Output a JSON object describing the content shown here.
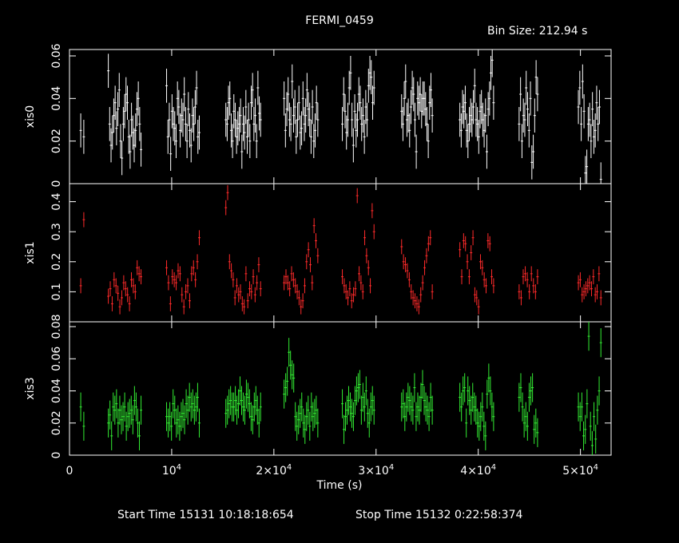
{
  "chart_data": {
    "type": "scatter",
    "title": "FERMI_0459",
    "bin_size_label": "Bin Size: 212.94 s",
    "xlabel": "Time (s)",
    "xlim": [
      0,
      53000
    ],
    "x_ticks": [
      {
        "value": 0,
        "label": "0"
      },
      {
        "value": 10000,
        "label": "10^4"
      },
      {
        "value": 20000,
        "label": "2×10^4"
      },
      {
        "value": 30000,
        "label": "3×10^4"
      },
      {
        "value": 40000,
        "label": "4×10^4"
      },
      {
        "value": 50000,
        "label": "5×10^4"
      }
    ],
    "footer": {
      "start": "Start Time 15131 10:18:18:654",
      "stop": "Stop Time 15132  0:22:58:374"
    },
    "grid": false,
    "panels": [
      {
        "name": "xis0",
        "ylabel": "xis0",
        "color": "#ffffff",
        "ylim": [
          0,
          0.063
        ],
        "y_ticks": [
          {
            "value": 0,
            "label": "0"
          },
          {
            "value": 0.02,
            "label": "0.02"
          },
          {
            "value": 0.04,
            "label": "0.04"
          },
          {
            "value": 0.06,
            "label": "0.06"
          }
        ],
        "groups": [
          [
            1100,
            1400
          ],
          [
            3800,
            7000
          ],
          [
            9500,
            12700
          ],
          [
            15300,
            18700
          ],
          [
            21000,
            24300
          ],
          [
            26700,
            29800
          ],
          [
            32500,
            35500
          ],
          [
            38200,
            41500
          ],
          [
            44000,
            45800
          ],
          [
            49800,
            52000
          ]
        ],
        "values": [
          0.025,
          0.022,
          0.053,
          0.028,
          0.018,
          0.024,
          0.032,
          0.038,
          0.026,
          0.035,
          0.044,
          0.02,
          0.012,
          0.028,
          0.034,
          0.042,
          0.038,
          0.022,
          0.015,
          0.03,
          0.024,
          0.018,
          0.025,
          0.035,
          0.04,
          0.028,
          0.016,
          0.046,
          0.022,
          0.03,
          0.014,
          0.034,
          0.028,
          0.026,
          0.02,
          0.04,
          0.036,
          0.025,
          0.032,
          0.03,
          0.042,
          0.028,
          0.02,
          0.035,
          0.025,
          0.018,
          0.032,
          0.028,
          0.036,
          0.045,
          0.022,
          0.024,
          0.03,
          0.028,
          0.038,
          0.04,
          0.025,
          0.02,
          0.034,
          0.03,
          0.022,
          0.026,
          0.028,
          0.032,
          0.015,
          0.028,
          0.024,
          0.036,
          0.022,
          0.03,
          0.02,
          0.038,
          0.044,
          0.028,
          0.032,
          0.02,
          0.045,
          0.033,
          0.03,
          0.04,
          0.025,
          0.035,
          0.042,
          0.03,
          0.028,
          0.048,
          0.032,
          0.036,
          0.022,
          0.03,
          0.038,
          0.024,
          0.026,
          0.04,
          0.028,
          0.032,
          0.044,
          0.035,
          0.03,
          0.022,
          0.036,
          0.02,
          0.025,
          0.038,
          0.03,
          0.028,
          0.042,
          0.034,
          0.024,
          0.03,
          0.045,
          0.052,
          0.03,
          0.018,
          0.034,
          0.025,
          0.03,
          0.042,
          0.038,
          0.028,
          0.032,
          0.022,
          0.036,
          0.03,
          0.046,
          0.052,
          0.05,
          0.038,
          0.045,
          0.034,
          0.028,
          0.04,
          0.048,
          0.03,
          0.032,
          0.025,
          0.036,
          0.045,
          0.042,
          0.03,
          0.015,
          0.04,
          0.038,
          0.042,
          0.034,
          0.04,
          0.04,
          0.035,
          0.028,
          0.02,
          0.038,
          0.044,
          0.032,
          0.03,
          0.025,
          0.036,
          0.034,
          0.038,
          0.025,
          0.02,
          0.028,
          0.032,
          0.03,
          0.036,
          0.046,
          0.03,
          0.028,
          0.022,
          0.034,
          0.036,
          0.03,
          0.025,
          0.032,
          0.015,
          0.035,
          0.04,
          0.052,
          0.058,
          0.038,
          0.028,
          0.042,
          0.02,
          0.032,
          0.03,
          0.045,
          0.035,
          0.025,
          0.04,
          0.01,
          0.015,
          0.032,
          0.05,
          0.042,
          0.036,
          0.045,
          0.028,
          0.048,
          0.034,
          0.005,
          0.008,
          0.028,
          0.03,
          0.02,
          0.035,
          0.022,
          0.025,
          0.038,
          0.028,
          0.036,
          0.002
        ],
        "err": 0.008
      },
      {
        "name": "xis1",
        "ylabel": "xis1",
        "color": "#ff2a2a",
        "ylim": [
          0,
          0.46
        ],
        "y_ticks": [
          {
            "value": 0.1,
            "label": "0.1"
          },
          {
            "value": 0.2,
            "label": "0.2"
          },
          {
            "value": 0.3,
            "label": "0.3"
          },
          {
            "value": 0.4,
            "label": "0.4"
          }
        ],
        "groups": [
          [
            1100,
            1400
          ],
          [
            3800,
            7000
          ],
          [
            9500,
            12700
          ],
          [
            15300,
            18700
          ],
          [
            21000,
            24300
          ],
          [
            26700,
            29800
          ],
          [
            32500,
            35500
          ],
          [
            38200,
            41500
          ],
          [
            44000,
            45800
          ],
          [
            49800,
            52000
          ]
        ],
        "values": [
          0.12,
          0.34,
          0.085,
          0.11,
          0.06,
          0.14,
          0.12,
          0.095,
          0.05,
          0.08,
          0.13,
          0.11,
          0.09,
          0.06,
          0.14,
          0.12,
          0.1,
          0.18,
          0.16,
          0.15,
          0.18,
          0.13,
          0.06,
          0.15,
          0.14,
          0.13,
          0.17,
          0.16,
          0.09,
          0.05,
          0.1,
          0.12,
          0.07,
          0.16,
          0.18,
          0.14,
          0.2,
          0.28,
          0.38,
          0.43,
          0.2,
          0.17,
          0.14,
          0.08,
          0.12,
          0.09,
          0.1,
          0.06,
          0.05,
          0.16,
          0.07,
          0.11,
          0.1,
          0.15,
          0.09,
          0.13,
          0.19,
          0.11,
          0.13,
          0.15,
          0.13,
          0.11,
          0.16,
          0.14,
          0.12,
          0.1,
          0.08,
          0.05,
          0.07,
          0.12,
          0.2,
          0.24,
          0.19,
          0.13,
          0.32,
          0.27,
          0.22,
          0.15,
          0.12,
          0.1,
          0.08,
          0.11,
          0.07,
          0.09,
          0.11,
          0.42,
          0.16,
          0.13,
          0.1,
          0.28,
          0.22,
          0.18,
          0.12,
          0.37,
          0.3,
          0.25,
          0.2,
          0.19,
          0.17,
          0.14,
          0.1,
          0.08,
          0.07,
          0.06,
          0.05,
          0.09,
          0.13,
          0.18,
          0.22,
          0.26,
          0.28,
          0.1,
          0.24,
          0.15,
          0.27,
          0.26,
          0.2,
          0.15,
          0.23,
          0.28,
          0.09,
          0.08,
          0.05,
          0.2,
          0.18,
          0.14,
          0.12,
          0.27,
          0.26,
          0.15,
          0.12,
          0.1,
          0.08,
          0.15,
          0.16,
          0.14,
          0.1,
          0.16,
          0.12,
          0.1,
          0.15,
          0.13,
          0.14,
          0.09,
          0.1,
          0.11,
          0.12,
          0.13,
          0.11,
          0.15,
          0.09,
          0.1,
          0.16,
          0.08
        ],
        "err": 0.025
      },
      {
        "name": "xis3",
        "ylabel": "xis3",
        "color": "#33ee33",
        "ylim": [
          0,
          0.083
        ],
        "y_ticks": [
          {
            "value": 0,
            "label": "0"
          },
          {
            "value": 0.02,
            "label": "0.02"
          },
          {
            "value": 0.04,
            "label": "0.04"
          },
          {
            "value": 0.06,
            "label": "0.06"
          },
          {
            "value": 0.08,
            "label": "0.08"
          }
        ],
        "groups": [
          [
            1100,
            1400
          ],
          [
            3800,
            7000
          ],
          [
            9500,
            12700
          ],
          [
            15300,
            18700
          ],
          [
            21000,
            24300
          ],
          [
            26700,
            29800
          ],
          [
            32500,
            35500
          ],
          [
            38200,
            41500
          ],
          [
            44000,
            45800
          ],
          [
            49800,
            52000
          ]
        ],
        "values": [
          0.03,
          0.018,
          0.02,
          0.025,
          0.012,
          0.03,
          0.028,
          0.032,
          0.02,
          0.028,
          0.022,
          0.024,
          0.03,
          0.018,
          0.024,
          0.026,
          0.028,
          0.022,
          0.034,
          0.03,
          0.02,
          0.012,
          0.028,
          0.024,
          0.02,
          0.024,
          0.018,
          0.032,
          0.028,
          0.02,
          0.022,
          0.018,
          0.024,
          0.026,
          0.022,
          0.032,
          0.028,
          0.036,
          0.03,
          0.032,
          0.028,
          0.03,
          0.036,
          0.02,
          0.026,
          0.028,
          0.032,
          0.034,
          0.03,
          0.03,
          0.034,
          0.028,
          0.032,
          0.04,
          0.034,
          0.03,
          0.028,
          0.038,
          0.036,
          0.032,
          0.024,
          0.022,
          0.03,
          0.034,
          0.028,
          0.02,
          0.03,
          0.038,
          0.042,
          0.046,
          0.064,
          0.056,
          0.05,
          0.048,
          0.024,
          0.018,
          0.022,
          0.026,
          0.03,
          0.02,
          0.016,
          0.024,
          0.028,
          0.018,
          0.03,
          0.024,
          0.026,
          0.028,
          0.02,
          0.032,
          0.016,
          0.024,
          0.028,
          0.034,
          0.03,
          0.026,
          0.024,
          0.034,
          0.04,
          0.042,
          0.044,
          0.028,
          0.036,
          0.03,
          0.04,
          0.026,
          0.02,
          0.03,
          0.034,
          0.028,
          0.03,
          0.032,
          0.024,
          0.03,
          0.036,
          0.034,
          0.03,
          0.028,
          0.042,
          0.024,
          0.03,
          0.028,
          0.036,
          0.044,
          0.034,
          0.03,
          0.028,
          0.024,
          0.036,
          0.028,
          0.036,
          0.03,
          0.04,
          0.042,
          0.02,
          0.04,
          0.034,
          0.028,
          0.036,
          0.03,
          0.028,
          0.02,
          0.018,
          0.024,
          0.03,
          0.018,
          0.012,
          0.038,
          0.048,
          0.04,
          0.03,
          0.024,
          0.036,
          0.042,
          0.03,
          0.02,
          0.024,
          0.018,
          0.036,
          0.04,
          0.042,
          0.016,
          0.02,
          0.014,
          0.03,
          0.024,
          0.03,
          0.012,
          0.016,
          0.032,
          0.074,
          0.018,
          0.006,
          0.024,
          0.01,
          0.028,
          0.04,
          0.07
        ],
        "err": 0.009
      }
    ]
  }
}
